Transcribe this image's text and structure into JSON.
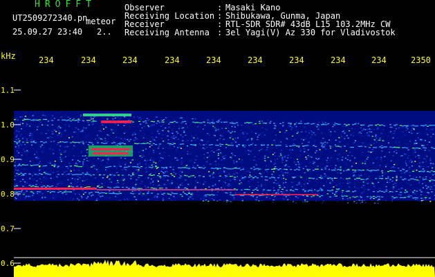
{
  "app": {
    "title": "HROFFT"
  },
  "file": {
    "name": "UT2509272340.pn",
    "tag": "meteor"
  },
  "timestamp": {
    "datetime": "25.09.27 23:40",
    "minute_mark": "2.."
  },
  "header": {
    "rows": [
      {
        "key": "Observer",
        "value": "Masaki Kano"
      },
      {
        "key": "Receiving Location",
        "value": "Shibukawa, Gunma, Japan"
      },
      {
        "key": "Receiver",
        "value": "RTL-SDR SDR# 43dB L15 103.2MHz CW"
      },
      {
        "key": "Receiving Antenna",
        "value": "3el Yagi(V) Az 330 for Vladivostok"
      }
    ]
  },
  "frequency_axis": {
    "unit": "kHz",
    "ticks": [
      "1.1",
      "1.0",
      "0.9",
      "0.8",
      "0.7",
      "0.6"
    ]
  },
  "time_axis": {
    "ticks": [
      "234",
      "234",
      "234",
      "234",
      "234",
      "234",
      "234",
      "234",
      "234",
      "2350"
    ]
  },
  "colors": {
    "text_green": "#38e038",
    "text_white": "#ffffff",
    "tick_yellow": "#ffff00",
    "signal_red": "#ff2050",
    "noise_blue": "#1030c0"
  }
}
